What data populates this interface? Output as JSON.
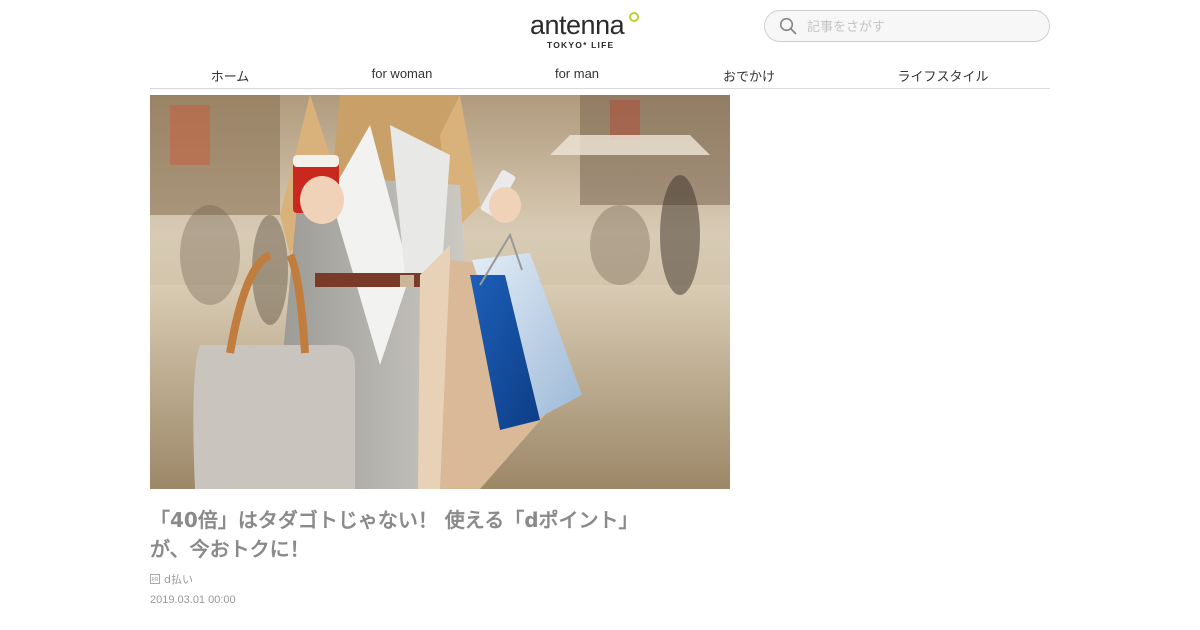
{
  "brand": {
    "name": "antenna",
    "tagline": "TOKYO* LIFE",
    "accent_color": "#b8d430"
  },
  "search": {
    "placeholder": "記事をさがす",
    "icon": "search-icon"
  },
  "nav": {
    "items": [
      {
        "label": "ホーム"
      },
      {
        "label": "for woman"
      },
      {
        "label": "for man"
      },
      {
        "label": "おでかけ"
      },
      {
        "label": "ライフスタイル"
      }
    ]
  },
  "article": {
    "title_line1": "「40倍」はタダゴトじゃない！ 使える「dポイント」",
    "title_line2": "が、今おトクに！",
    "pr_label": "PR",
    "sponsor": "d払い",
    "date": "2019.03.01 00:00"
  }
}
